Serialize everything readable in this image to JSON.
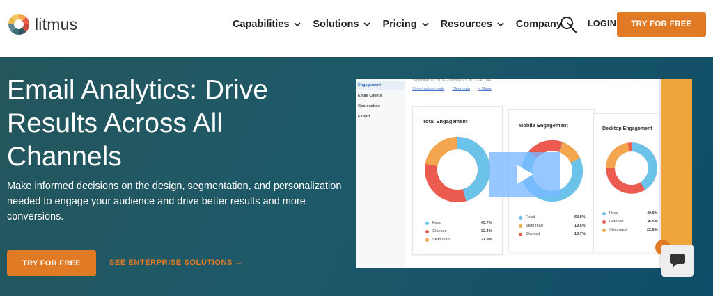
{
  "header": {
    "logo_text": "litmus",
    "nav": [
      {
        "label": "Capabilities"
      },
      {
        "label": "Solutions"
      },
      {
        "label": "Pricing"
      },
      {
        "label": "Resources"
      },
      {
        "label": "Company"
      }
    ],
    "search_icon": "search-icon",
    "login_label": "LOGIN",
    "cta_label": "TRY FOR FREE"
  },
  "hero": {
    "title": "Email Analytics: Drive Results Across All Channels",
    "description": "Make informed decisions on the design, segmentation, and personalization needed to engage your audience and drive better results and more conversions.",
    "cta_label": "TRY FOR FREE",
    "secondary_label": "SEE ENTERPRISE SOLUTIONS →"
  },
  "video": {
    "sidebar": [
      "Engagement",
      "Email Clients",
      "Geolocation",
      "Export"
    ],
    "date_range": "September 13, 2019  —  October 13, 2019   •  ACTIVE",
    "links": [
      "View tracking code",
      "Clear data",
      "< Share"
    ],
    "cards": [
      {
        "title": "Total Engagement",
        "legend": [
          {
            "label": "Read",
            "value": "45.7%"
          },
          {
            "label": "Glanced",
            "value": "32.4%"
          },
          {
            "label": "Skim read",
            "value": "21.9%"
          }
        ]
      },
      {
        "title": "Mobile Engagement",
        "legend": [
          {
            "label": "Read",
            "value": "63.8%"
          },
          {
            "label": "Skim read",
            "value": "19.5%"
          },
          {
            "label": "Glanced",
            "value": "16.7%"
          }
        ]
      },
      {
        "title": "Desktop Engagement",
        "legend": [
          {
            "label": "Read",
            "value": "40.9%"
          },
          {
            "label": "Glanced",
            "value": "36.5%"
          },
          {
            "label": "Skim read",
            "value": "22.6%"
          }
        ]
      }
    ],
    "play_icon": "play-icon"
  },
  "chat_icon": "chat-icon",
  "colors": {
    "accent": "#e07a24",
    "read": "#6cc3ea",
    "glanced": "#ec5b4f",
    "skim": "#f3a64d"
  }
}
